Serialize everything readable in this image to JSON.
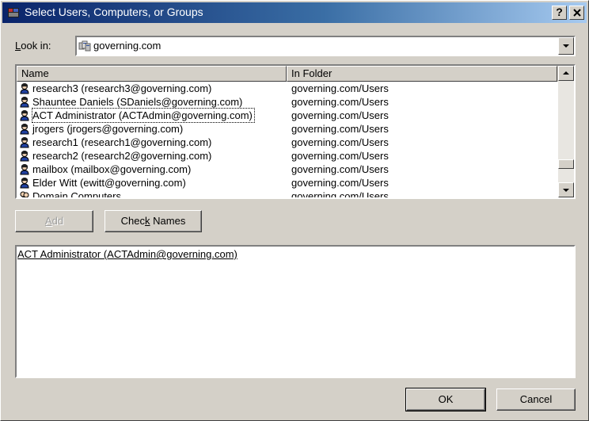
{
  "window": {
    "title": "Select Users, Computers, or Groups",
    "help_label": "?",
    "close_label": "✕"
  },
  "lookin": {
    "label_prefix": "",
    "label_key": "L",
    "label_rest": "ook in:",
    "value": "governing.com",
    "icon": "domain-icon"
  },
  "list": {
    "columns": [
      "Name",
      "In Folder"
    ],
    "rows": [
      {
        "name": "research3 (research3@governing.com)",
        "folder": "governing.com/Users",
        "icon": "user-icon"
      },
      {
        "name": "Shauntee Daniels (SDaniels@governing.com)",
        "folder": "governing.com/Users",
        "icon": "user-icon"
      },
      {
        "name": "ACT Administrator (ACTAdmin@governing.com)",
        "folder": "governing.com/Users",
        "icon": "user-icon"
      },
      {
        "name": "jrogers (jrogers@governing.com)",
        "folder": "governing.com/Users",
        "icon": "user-icon"
      },
      {
        "name": "research1 (research1@governing.com)",
        "folder": "governing.com/Users",
        "icon": "user-icon"
      },
      {
        "name": "research2 (research2@governing.com)",
        "folder": "governing.com/Users",
        "icon": "user-icon"
      },
      {
        "name": "mailbox (mailbox@governing.com)",
        "folder": "governing.com/Users",
        "icon": "user-icon"
      },
      {
        "name": "Elder Witt (ewitt@governing.com)",
        "folder": "governing.com/Users",
        "icon": "user-icon"
      },
      {
        "name": "Domain Computers",
        "folder": "governing.com/Users",
        "icon": "group-icon"
      }
    ]
  },
  "buttons": {
    "add_key": "A",
    "add_rest": "dd",
    "check_pre": "Chec",
    "check_key": "k",
    "check_post": " Names",
    "ok": "OK",
    "cancel": "Cancel"
  },
  "selected": {
    "entry": "ACT Administrator (ACTAdmin@governing.com)"
  },
  "colors": {
    "title_start": "#0a246a",
    "title_end": "#a6caf0",
    "face": "#d4d0c8"
  }
}
